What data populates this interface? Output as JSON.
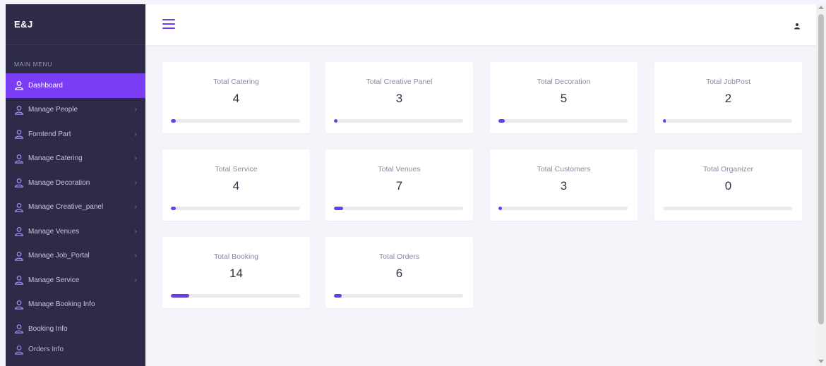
{
  "brand": "E&J",
  "menu_title": "MAIN MENU",
  "menu": [
    {
      "label": "Dashboard",
      "active": true,
      "chevron": ""
    },
    {
      "label": "Manage People",
      "active": false,
      "chevron": "›"
    },
    {
      "label": "Fomtend Part",
      "active": false,
      "chevron": "›"
    },
    {
      "label": "Manage Catering",
      "active": false,
      "chevron": "›"
    },
    {
      "label": "Manage Decoration",
      "active": false,
      "chevron": "›"
    },
    {
      "label": "Manage Creative_panel",
      "active": false,
      "chevron": "›"
    },
    {
      "label": "Manage Venues",
      "active": false,
      "chevron": "›"
    },
    {
      "label": "Manage Job_Portal",
      "active": false,
      "chevron": "›"
    },
    {
      "label": "Manage Service",
      "active": false,
      "chevron": "›"
    },
    {
      "label": "Manage Booking Info",
      "active": false,
      "chevron": ""
    },
    {
      "label": "Booking Info",
      "active": false,
      "chevron": ""
    },
    {
      "label": "Orders Info",
      "active": false,
      "chevron": ""
    }
  ],
  "colors": {
    "sidebar": "#2d2b47",
    "accent": "#7a3df4",
    "progress": "#6a3cf0"
  },
  "icons": {
    "menu": "hamburger-icon",
    "user": "user-icon",
    "menu_item": "user-outline-icon"
  },
  "cards": [
    {
      "title": "Total Catering",
      "value": "4",
      "progress": 0.04
    },
    {
      "title": "Total Creative Panel",
      "value": "3",
      "progress": 0.03
    },
    {
      "title": "Total Decoration",
      "value": "5",
      "progress": 0.05
    },
    {
      "title": "Total JobPost",
      "value": "2",
      "progress": 0.02
    },
    {
      "title": "Total Service",
      "value": "4",
      "progress": 0.04
    },
    {
      "title": "Total Venues",
      "value": "7",
      "progress": 0.07
    },
    {
      "title": "Total Customers",
      "value": "3",
      "progress": 0.03
    },
    {
      "title": "Total Organizer",
      "value": "0",
      "progress": 0.0
    },
    {
      "title": "Total Booking",
      "value": "14",
      "progress": 0.14
    },
    {
      "title": "Total Orders",
      "value": "6",
      "progress": 0.06
    }
  ]
}
